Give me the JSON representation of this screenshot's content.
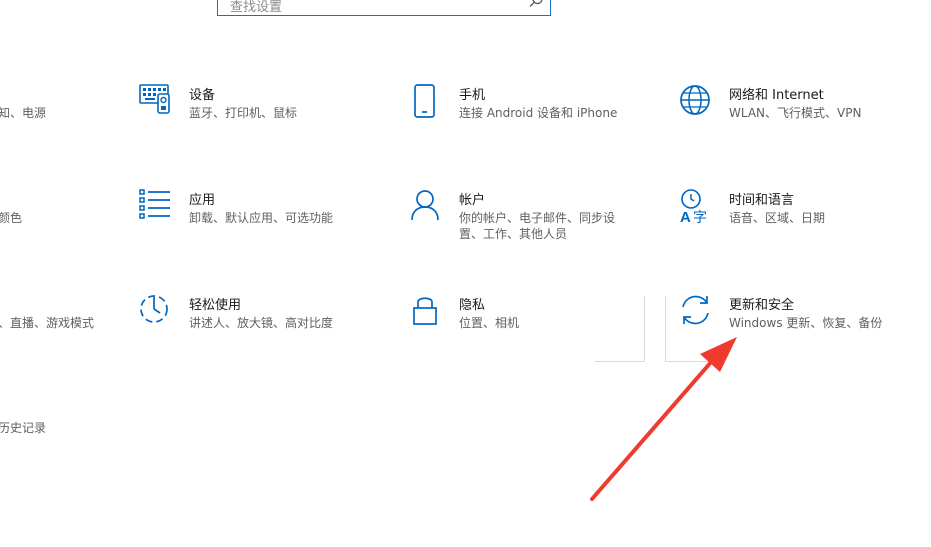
{
  "search": {
    "placeholder": "查找设置"
  },
  "left_partial": [
    "知、电源",
    "颜色",
    "、直播、游戏模式",
    "历史记录"
  ],
  "tiles": [
    {
      "title": "设备",
      "desc": "蓝牙、打印机、鼠标",
      "icon": "keyboard-icon"
    },
    {
      "title": "手机",
      "desc": "连接 Android 设备和 iPhone",
      "icon": "phone-icon"
    },
    {
      "title": "网络和 Internet",
      "desc": "WLAN、飞行模式、VPN",
      "icon": "globe-icon"
    },
    {
      "title": "应用",
      "desc": "卸载、默认应用、可选功能",
      "icon": "apps-list-icon"
    },
    {
      "title": "帐户",
      "desc": "你的帐户、电子邮件、同步设置、工作、其他人员",
      "icon": "person-icon"
    },
    {
      "title": "时间和语言",
      "desc": "语音、区域、日期",
      "icon": "time-language-icon"
    },
    {
      "title": "轻松使用",
      "desc": "讲述人、放大镜、高对比度",
      "icon": "ease-of-access-icon"
    },
    {
      "title": "隐私",
      "desc": "位置、相机",
      "icon": "lock-icon"
    },
    {
      "title": "更新和安全",
      "desc": "Windows 更新、恢复、备份",
      "icon": "sync-icon"
    }
  ],
  "colors": {
    "accent": "#0067c0",
    "arrow": "#f03a2e"
  }
}
